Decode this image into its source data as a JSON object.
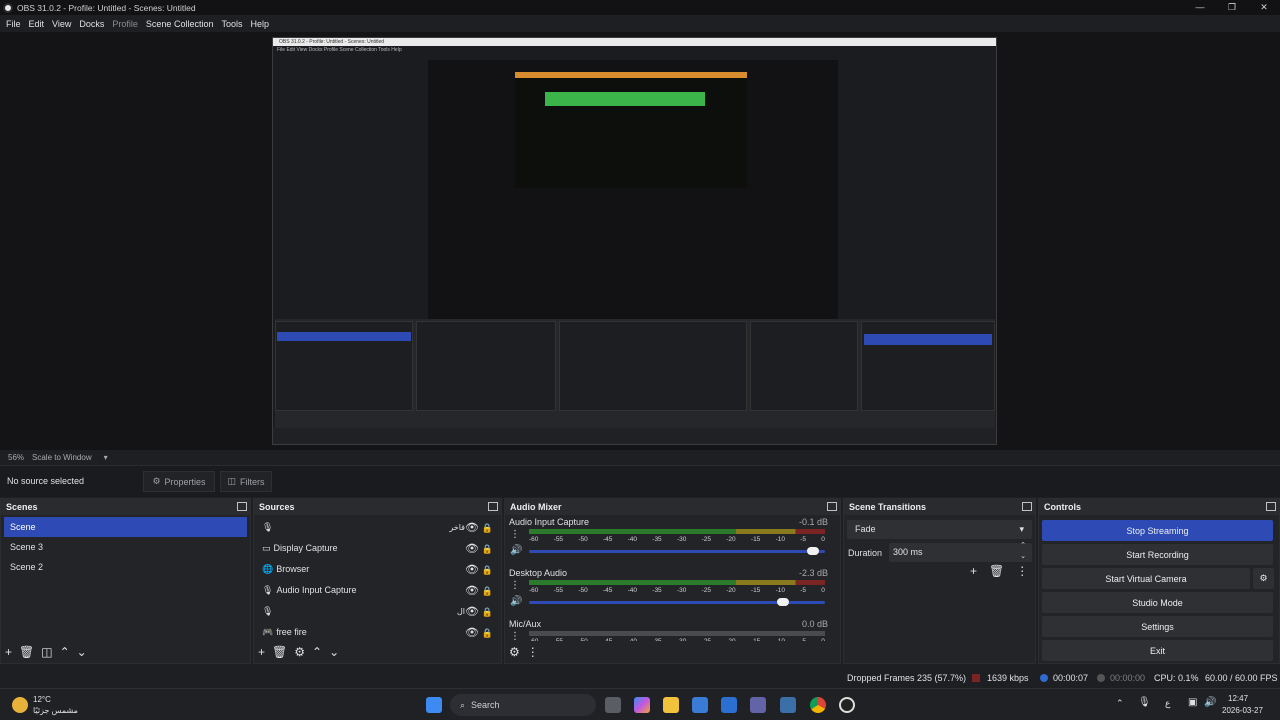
{
  "window": {
    "title": "OBS 31.0.2 - Profile: Untitled - Scenes: Untitled",
    "controls": [
      "—",
      "❐",
      "✕"
    ]
  },
  "menu": [
    "File",
    "Edit",
    "View",
    "Docks",
    "Profile",
    "Scene Collection",
    "Tools",
    "Help"
  ],
  "preview_bar": {
    "zoom": "56%",
    "mode": "Scale to Window"
  },
  "source_bar": {
    "no_source": "No source selected",
    "properties": "Properties",
    "filters": "Filters"
  },
  "scenes": {
    "title": "Scenes",
    "items": [
      "Scene",
      "Scene 3",
      "Scene 2"
    ],
    "active_index": 0
  },
  "sources": {
    "title": "Sources",
    "items": [
      {
        "label": "",
        "icon": "mic-icon",
        "rtl_label": "فاخر"
      },
      {
        "label": "Display Capture",
        "icon": "monitor-icon"
      },
      {
        "label": "Browser",
        "icon": "globe-icon"
      },
      {
        "label": "Audio Input Capture",
        "icon": "mic-icon"
      },
      {
        "label": "",
        "icon": "mic-icon",
        "rtl_label": "ال"
      },
      {
        "label": "free fire",
        "icon": "gamepad-icon"
      }
    ]
  },
  "audio_mixer": {
    "title": "Audio Mixer",
    "ticks": [
      "-60",
      "-55",
      "-50",
      "-45",
      "-40",
      "-35",
      "-30",
      "-25",
      "-20",
      "-15",
      "-10",
      "-5",
      "0"
    ],
    "channels": [
      {
        "name": "Audio Input Capture",
        "db": "-0.1 dB",
        "volume": 0.98,
        "active": true
      },
      {
        "name": "Desktop Audio",
        "db": "-2.3 dB",
        "volume": 0.88,
        "active": true
      },
      {
        "name": "Mic/Aux",
        "db": "0.0 dB",
        "volume": 1.0,
        "active": false
      }
    ]
  },
  "transitions": {
    "title": "Scene Transitions",
    "transition": "Fade",
    "duration_label": "Duration",
    "duration_value": "300 ms"
  },
  "controls": {
    "title": "Controls",
    "stop_streaming": "Stop Streaming",
    "start_recording": "Start Recording",
    "start_virtual_camera": "Start Virtual Camera",
    "studio_mode": "Studio Mode",
    "settings": "Settings",
    "exit": "Exit"
  },
  "status": {
    "dropped_frames": "Dropped Frames 235 (57.7%)",
    "bitrate": "1639 kbps",
    "stream_time": "00:00:07",
    "record_time": "00:00:00",
    "cpu": "CPU: 0.1%",
    "fps": "60.00 / 60.00 FPS"
  },
  "taskbar": {
    "weather_temp": "12°C",
    "weather_desc": "مشمس جزئيًا",
    "search": "Search",
    "lang": "ع",
    "time": "12:47",
    "date": "2026-03-27"
  },
  "nested_preview": {
    "title": "OBS 31.0.2 - Profile: Untitled - Scenes: Untitled"
  },
  "colors": {
    "accent": "#2e4bb5",
    "panel": "#232427",
    "background": "#1e1f22"
  }
}
